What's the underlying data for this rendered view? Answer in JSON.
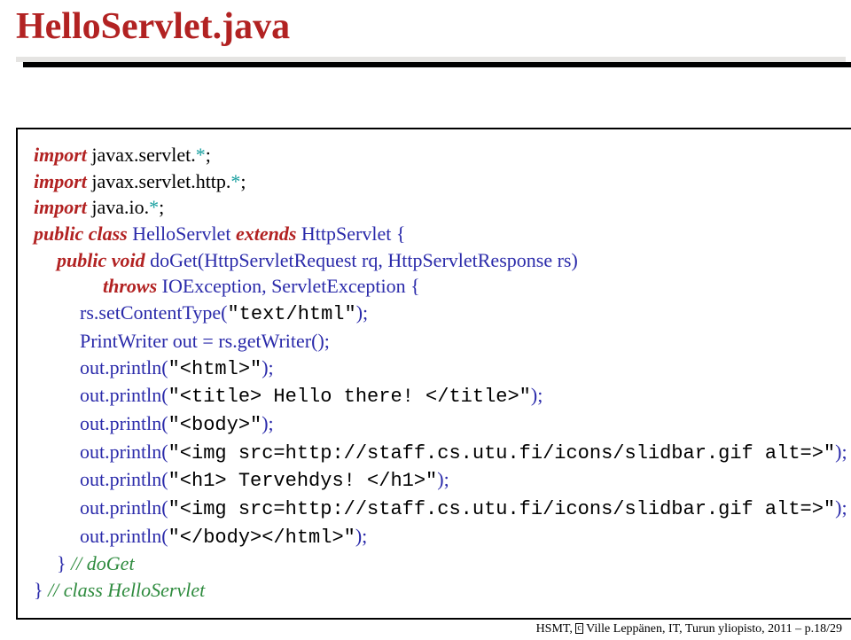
{
  "title": "HelloServlet.java",
  "code": {
    "l1a": "import",
    "l1b": " javax.servlet.",
    "l1c": "*",
    "l1d": ";",
    "l2a": "import",
    "l2b": " javax.servlet.http.",
    "l2c": "*",
    "l2d": ";",
    "l3a": "import",
    "l3b": " java.io.",
    "l3c": "*",
    "l3d": ";",
    "l4a": "public class",
    "l4b": " HelloServlet ",
    "l4c": "extends",
    "l4d": " HttpServlet {",
    "l5a": "public void",
    "l5b": " doGet(HttpServletRequest rq, HttpServletResponse rs)",
    "l6a": "throws",
    "l6b": " IOException, ServletException {",
    "l7a": "rs.setContentType(",
    "l7b": "\"text/html\"",
    "l7c": ");",
    "l8a": "PrintWriter out = rs.getWriter();",
    "l9a": "out.println(",
    "l9b": "\"<html>\"",
    "l9c": ");",
    "l10a": "out.println(",
    "l10b": "\"<title> Hello there! </title>\"",
    "l10c": ");",
    "l11a": "out.println(",
    "l11b": "\"<body>\"",
    "l11c": ");",
    "l12a": "out.println(",
    "l12b": "\"<img src=http://staff.cs.utu.fi/icons/slidbar.gif alt=>\"",
    "l12c": ");",
    "l13a": "out.println(",
    "l13b": "\"<h1> Tervehdys! </h1>\"",
    "l13c": ");",
    "l14a": "out.println(",
    "l14b": "\"<img src=http://staff.cs.utu.fi/icons/slidbar.gif alt=>\"",
    "l14c": ");",
    "l15a": "out.println(",
    "l15b": "\"</body></html>\"",
    "l15c": ");",
    "l16a": "}  ",
    "l16b": "// doGet",
    "l17a": "}  ",
    "l17b": "// class HelloServlet"
  },
  "footer": {
    "left": "HSMT, ",
    "c": "c",
    "rest": " Ville Leppänen, IT, Turun yliopisto, 2011 – p.18/29"
  }
}
